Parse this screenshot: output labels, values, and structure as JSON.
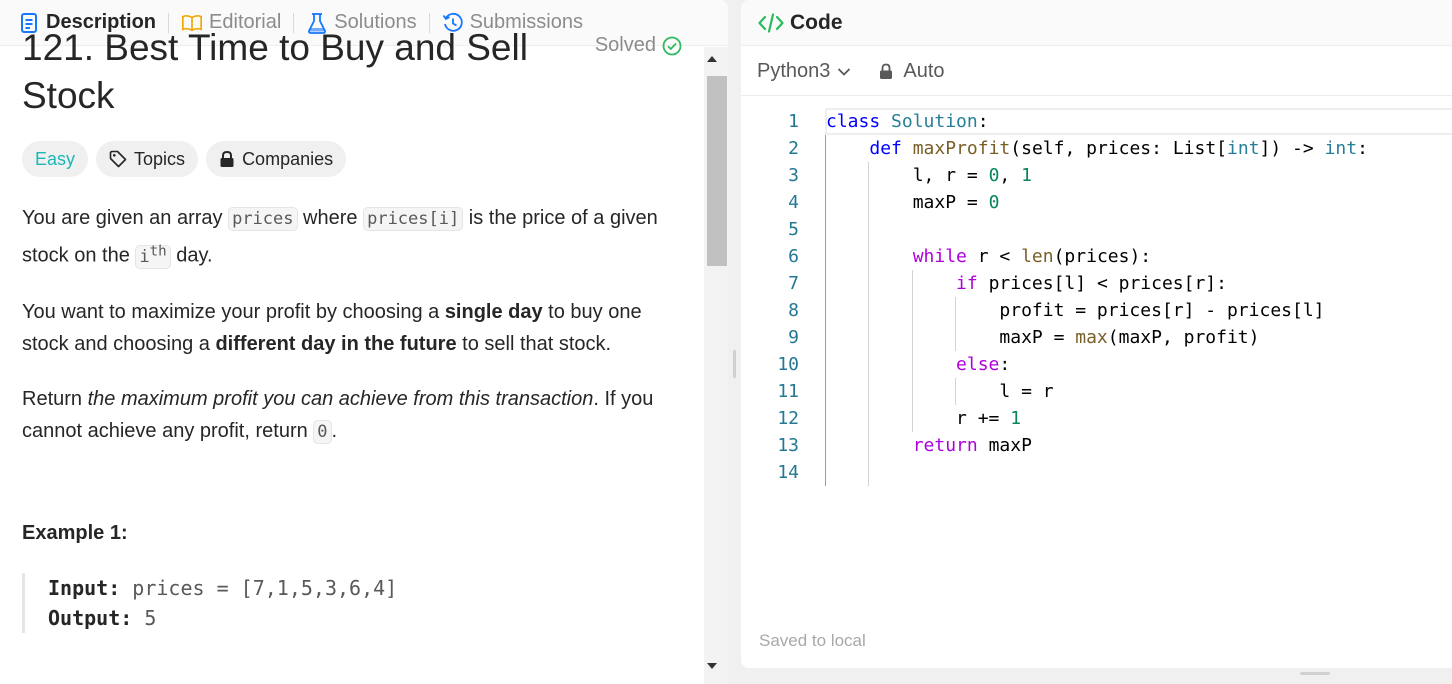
{
  "tabs": [
    {
      "label": "Description",
      "icon": "document-icon"
    },
    {
      "label": "Editorial",
      "icon": "book-icon"
    },
    {
      "label": "Solutions",
      "icon": "flask-icon"
    },
    {
      "label": "Submissions",
      "icon": "history-icon"
    }
  ],
  "problem": {
    "title": "121. Best Time to Buy and Sell Stock",
    "status": "Solved",
    "tags": {
      "difficulty": "Easy",
      "topics": "Topics",
      "companies": "Companies"
    },
    "para1": {
      "a": "You are given an array ",
      "code1": "prices",
      "b": " where ",
      "code2": "prices[i]",
      "c": " is the price of a given stock on the ",
      "code3": "i",
      "sup": "th",
      "d": " day."
    },
    "para2": {
      "a": "You want to maximize your profit by choosing a ",
      "b1": "single day",
      "c": " to buy one stock and choosing a ",
      "b2": "different day in the future",
      "d": " to sell that stock."
    },
    "para3": {
      "a": "Return ",
      "em": "the maximum profit you can achieve from this transaction",
      "b": ". If you cannot achieve any profit, return ",
      "code": "0",
      "c": "."
    },
    "example": {
      "title": "Example 1:",
      "input_label": "Input:",
      "input_value": " prices = [7,1,5,3,6,4]",
      "output_label": "Output:",
      "output_value": " 5"
    }
  },
  "code_panel": {
    "title": "Code",
    "language": "Python3",
    "mode": "Auto",
    "saved_status": "Saved to local",
    "lines": [
      [
        [
          "kw",
          "class"
        ],
        [
          "txt",
          " "
        ],
        [
          "cls",
          "Solution"
        ],
        [
          "txt",
          ":"
        ]
      ],
      [
        [
          "txt",
          "    "
        ],
        [
          "kw",
          "def"
        ],
        [
          "txt",
          " "
        ],
        [
          "fn",
          "maxProfit"
        ],
        [
          "txt",
          "(self, prices: List["
        ],
        [
          "cls",
          "int"
        ],
        [
          "txt",
          "]) -> "
        ],
        [
          "cls",
          "int"
        ],
        [
          "txt",
          ":"
        ]
      ],
      [
        [
          "txt",
          "        l, r = "
        ],
        [
          "num",
          "0"
        ],
        [
          "txt",
          ", "
        ],
        [
          "num",
          "1"
        ]
      ],
      [
        [
          "txt",
          "        maxP = "
        ],
        [
          "num",
          "0"
        ]
      ],
      [],
      [
        [
          "txt",
          "        "
        ],
        [
          "ctl",
          "while"
        ],
        [
          "txt",
          " r < "
        ],
        [
          "fn",
          "len"
        ],
        [
          "txt",
          "(prices):"
        ]
      ],
      [
        [
          "txt",
          "            "
        ],
        [
          "ctl",
          "if"
        ],
        [
          "txt",
          " prices[l] < prices[r]:"
        ]
      ],
      [
        [
          "txt",
          "                profit = prices[r] - prices[l]"
        ]
      ],
      [
        [
          "txt",
          "                maxP = "
        ],
        [
          "fn",
          "max"
        ],
        [
          "txt",
          "(maxP, profit)"
        ]
      ],
      [
        [
          "txt",
          "            "
        ],
        [
          "ctl",
          "else"
        ],
        [
          "txt",
          ":"
        ]
      ],
      [
        [
          "txt",
          "                l = r"
        ]
      ],
      [
        [
          "txt",
          "            r += "
        ],
        [
          "num",
          "1"
        ]
      ],
      [
        [
          "txt",
          "        "
        ],
        [
          "ctl",
          "return"
        ],
        [
          "txt",
          " maxP"
        ]
      ],
      []
    ]
  },
  "colors": {
    "accent_easy": "#1cb8b8",
    "solved_green": "#2cbb5d",
    "keyword": "#0000ff",
    "control": "#af00db",
    "function": "#795e26",
    "type": "#267f99",
    "number": "#098658",
    "line_number": "#237893"
  }
}
